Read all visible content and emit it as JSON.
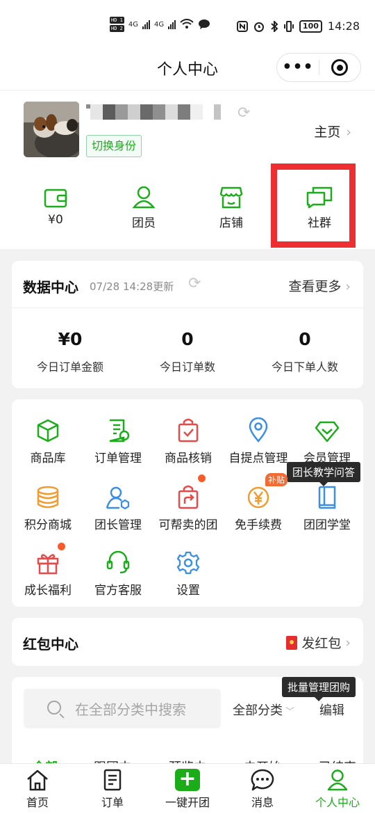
{
  "status_bar": {
    "hd1": "HD 1",
    "hd2": "HD 2",
    "net1": "4G",
    "net2": "4G",
    "battery": "100",
    "time": "14:28"
  },
  "header": {
    "title": "个人中心",
    "more_icon": "more-dots-icon",
    "close_icon": "target-icon"
  },
  "profile": {
    "switch_identity": "切换身份",
    "homepage": "主页",
    "quick": [
      {
        "icon": "wallet-icon",
        "label": "¥0"
      },
      {
        "icon": "member-icon",
        "label": "团员"
      },
      {
        "icon": "store-icon",
        "label": "店铺"
      },
      {
        "icon": "community-icon",
        "label": "社群"
      }
    ]
  },
  "data_center": {
    "title": "数据中心",
    "updated": "07/28 14:28更新",
    "more": "查看更多",
    "stats": [
      {
        "value": "¥0",
        "label": "今日订单金额"
      },
      {
        "value": "0",
        "label": "今日订单数"
      },
      {
        "value": "0",
        "label": "今日下单人数"
      }
    ]
  },
  "menu": {
    "items": [
      {
        "icon": "cube-icon",
        "label": "商品库"
      },
      {
        "icon": "order-doc-icon",
        "label": "订单管理"
      },
      {
        "icon": "verify-bag-icon",
        "label": "商品核销"
      },
      {
        "icon": "location-pin-icon",
        "label": "自提点管理"
      },
      {
        "icon": "diamond-icon",
        "label": "会员管理"
      },
      {
        "icon": "coin-stack-icon",
        "label": "积分商城"
      },
      {
        "icon": "leader-icon",
        "label": "团长管理"
      },
      {
        "icon": "share-bag-icon",
        "label": "可帮卖的团"
      },
      {
        "icon": "yen-coin-icon",
        "label": "免手续费"
      },
      {
        "icon": "book-icon",
        "label": "团团学堂"
      },
      {
        "icon": "gift-icon",
        "label": "成长福利"
      },
      {
        "icon": "headset-icon",
        "label": "官方客服"
      },
      {
        "icon": "gear-icon",
        "label": "设置"
      }
    ],
    "subsidy_badge": "补贴",
    "tooltip_teaching": "团长教学问答"
  },
  "red_packet": {
    "title": "红包中心",
    "send": "发红包"
  },
  "product_list": {
    "search_placeholder": "在全部分类中搜索",
    "category": "全部分类",
    "edit": "编辑",
    "tooltip_batch": "批量管理团购",
    "tabs": [
      "全部",
      "跟团中",
      "预览中",
      "未开始",
      "已结束"
    ]
  },
  "bottom_nav": {
    "items": [
      {
        "icon": "home-icon",
        "label": "首页"
      },
      {
        "icon": "order-list-icon",
        "label": "订单"
      },
      {
        "icon": "plus-icon",
        "label": "一键开团"
      },
      {
        "icon": "message-icon",
        "label": "消息"
      },
      {
        "icon": "profile-icon",
        "label": "个人中心"
      }
    ],
    "active_index": 4
  },
  "colors": {
    "brand_green": "#1aad19",
    "highlight_red": "#ee2e30",
    "badge_orange": "#f36a32"
  }
}
